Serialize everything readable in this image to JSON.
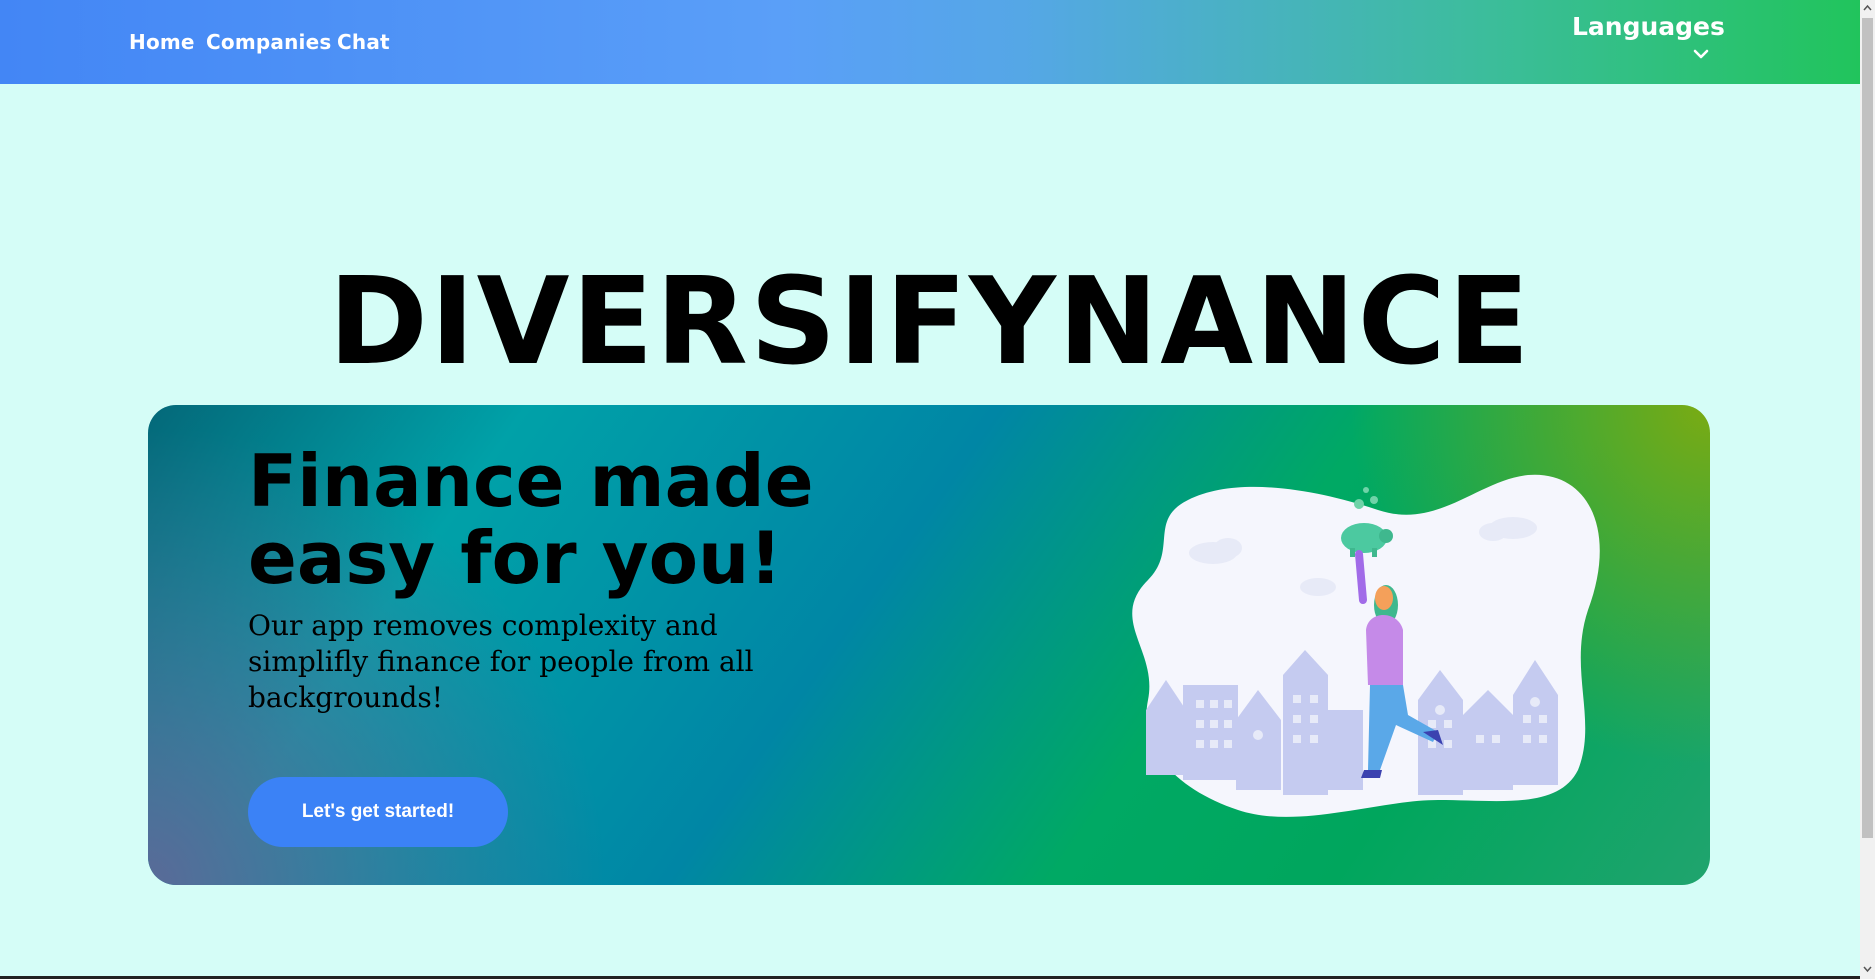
{
  "nav": {
    "links": [
      "Home",
      "Companies",
      "Chat"
    ],
    "languages_label": "Languages"
  },
  "brand": {
    "title": "DIVERSIFYNANCE"
  },
  "hero": {
    "heading_line1": "Finance made",
    "heading_line2": "easy for you!",
    "description": "Our app removes complexity and simplifly finance for people from all backgrounds!",
    "cta_label": "Let's get started!"
  },
  "icons": [
    "chevron-down-icon",
    "piggy-bank-icon"
  ],
  "colors": {
    "accent": "#3b82f6",
    "page_background": "#d5fdf7",
    "nav_gradient_start": "#4386f5",
    "nav_gradient_end": "#21c45c"
  }
}
